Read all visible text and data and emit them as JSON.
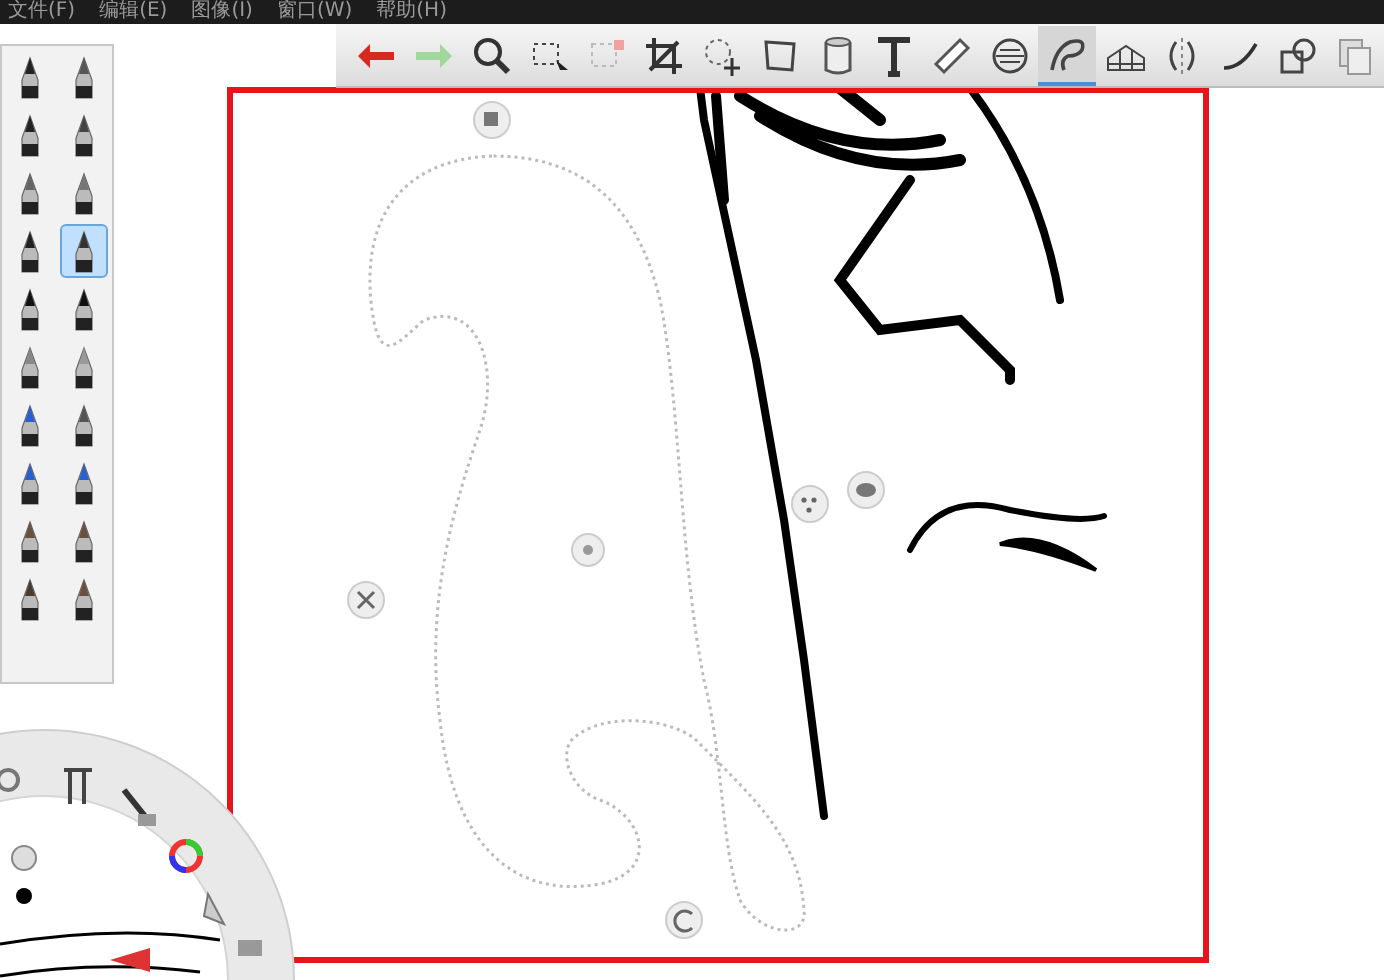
{
  "menu": [
    {
      "label": "文件(F)"
    },
    {
      "label": "编辑(E)"
    },
    {
      "label": "图像(I)"
    },
    {
      "label": "窗口(W)"
    },
    {
      "label": "帮助(H)"
    }
  ],
  "toolbar": [
    {
      "kind": "undo",
      "selected": false
    },
    {
      "kind": "redo",
      "selected": false
    },
    {
      "kind": "zoom",
      "selected": false
    },
    {
      "kind": "select",
      "selected": false
    },
    {
      "kind": "select2",
      "selected": false
    },
    {
      "kind": "crop",
      "selected": false
    },
    {
      "kind": "move",
      "selected": false
    },
    {
      "kind": "distort",
      "selected": false
    },
    {
      "kind": "fill",
      "selected": false
    },
    {
      "kind": "text",
      "selected": false
    },
    {
      "kind": "ruler",
      "selected": false
    },
    {
      "kind": "ellipse",
      "selected": false
    },
    {
      "kind": "curve",
      "selected": true
    },
    {
      "kind": "perspective",
      "selected": false
    },
    {
      "kind": "symmetry",
      "selected": false
    },
    {
      "kind": "stroke",
      "selected": false
    },
    {
      "kind": "shapes",
      "selected": false
    },
    {
      "kind": "layers",
      "selected": false
    }
  ],
  "brushes": [
    {
      "selected": false
    },
    {
      "selected": false
    },
    {
      "selected": false
    },
    {
      "selected": false
    },
    {
      "selected": false
    },
    {
      "selected": false
    },
    {
      "selected": false
    },
    {
      "selected": true
    },
    {
      "selected": false
    },
    {
      "selected": false
    },
    {
      "selected": false
    },
    {
      "selected": false
    },
    {
      "selected": false
    },
    {
      "selected": false
    },
    {
      "selected": false
    },
    {
      "selected": false
    },
    {
      "selected": false
    },
    {
      "selected": false
    },
    {
      "selected": false
    },
    {
      "selected": false
    }
  ]
}
